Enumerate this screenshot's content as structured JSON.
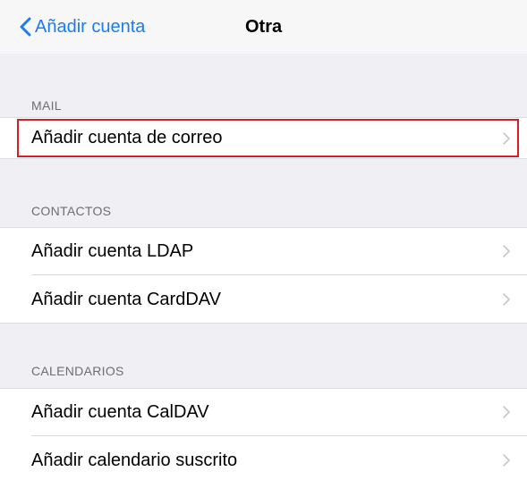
{
  "navbar": {
    "back_label": "Añadir cuenta",
    "title": "Otra"
  },
  "sections": [
    {
      "header": "MAIL",
      "rows": [
        {
          "label": "Añadir cuenta de correo"
        }
      ]
    },
    {
      "header": "CONTACTOS",
      "rows": [
        {
          "label": "Añadir cuenta LDAP"
        },
        {
          "label": "Añadir cuenta CardDAV"
        }
      ]
    },
    {
      "header": "CALENDARIOS",
      "rows": [
        {
          "label": "Añadir cuenta CalDAV"
        },
        {
          "label": "Añadir calendario suscrito"
        }
      ]
    }
  ],
  "colors": {
    "accent": "#1a7cf5",
    "highlight": "#d81e27",
    "background": "#efeff4"
  },
  "icons": {
    "back": "chevron-left-icon",
    "disclosure": "chevron-right-icon"
  }
}
